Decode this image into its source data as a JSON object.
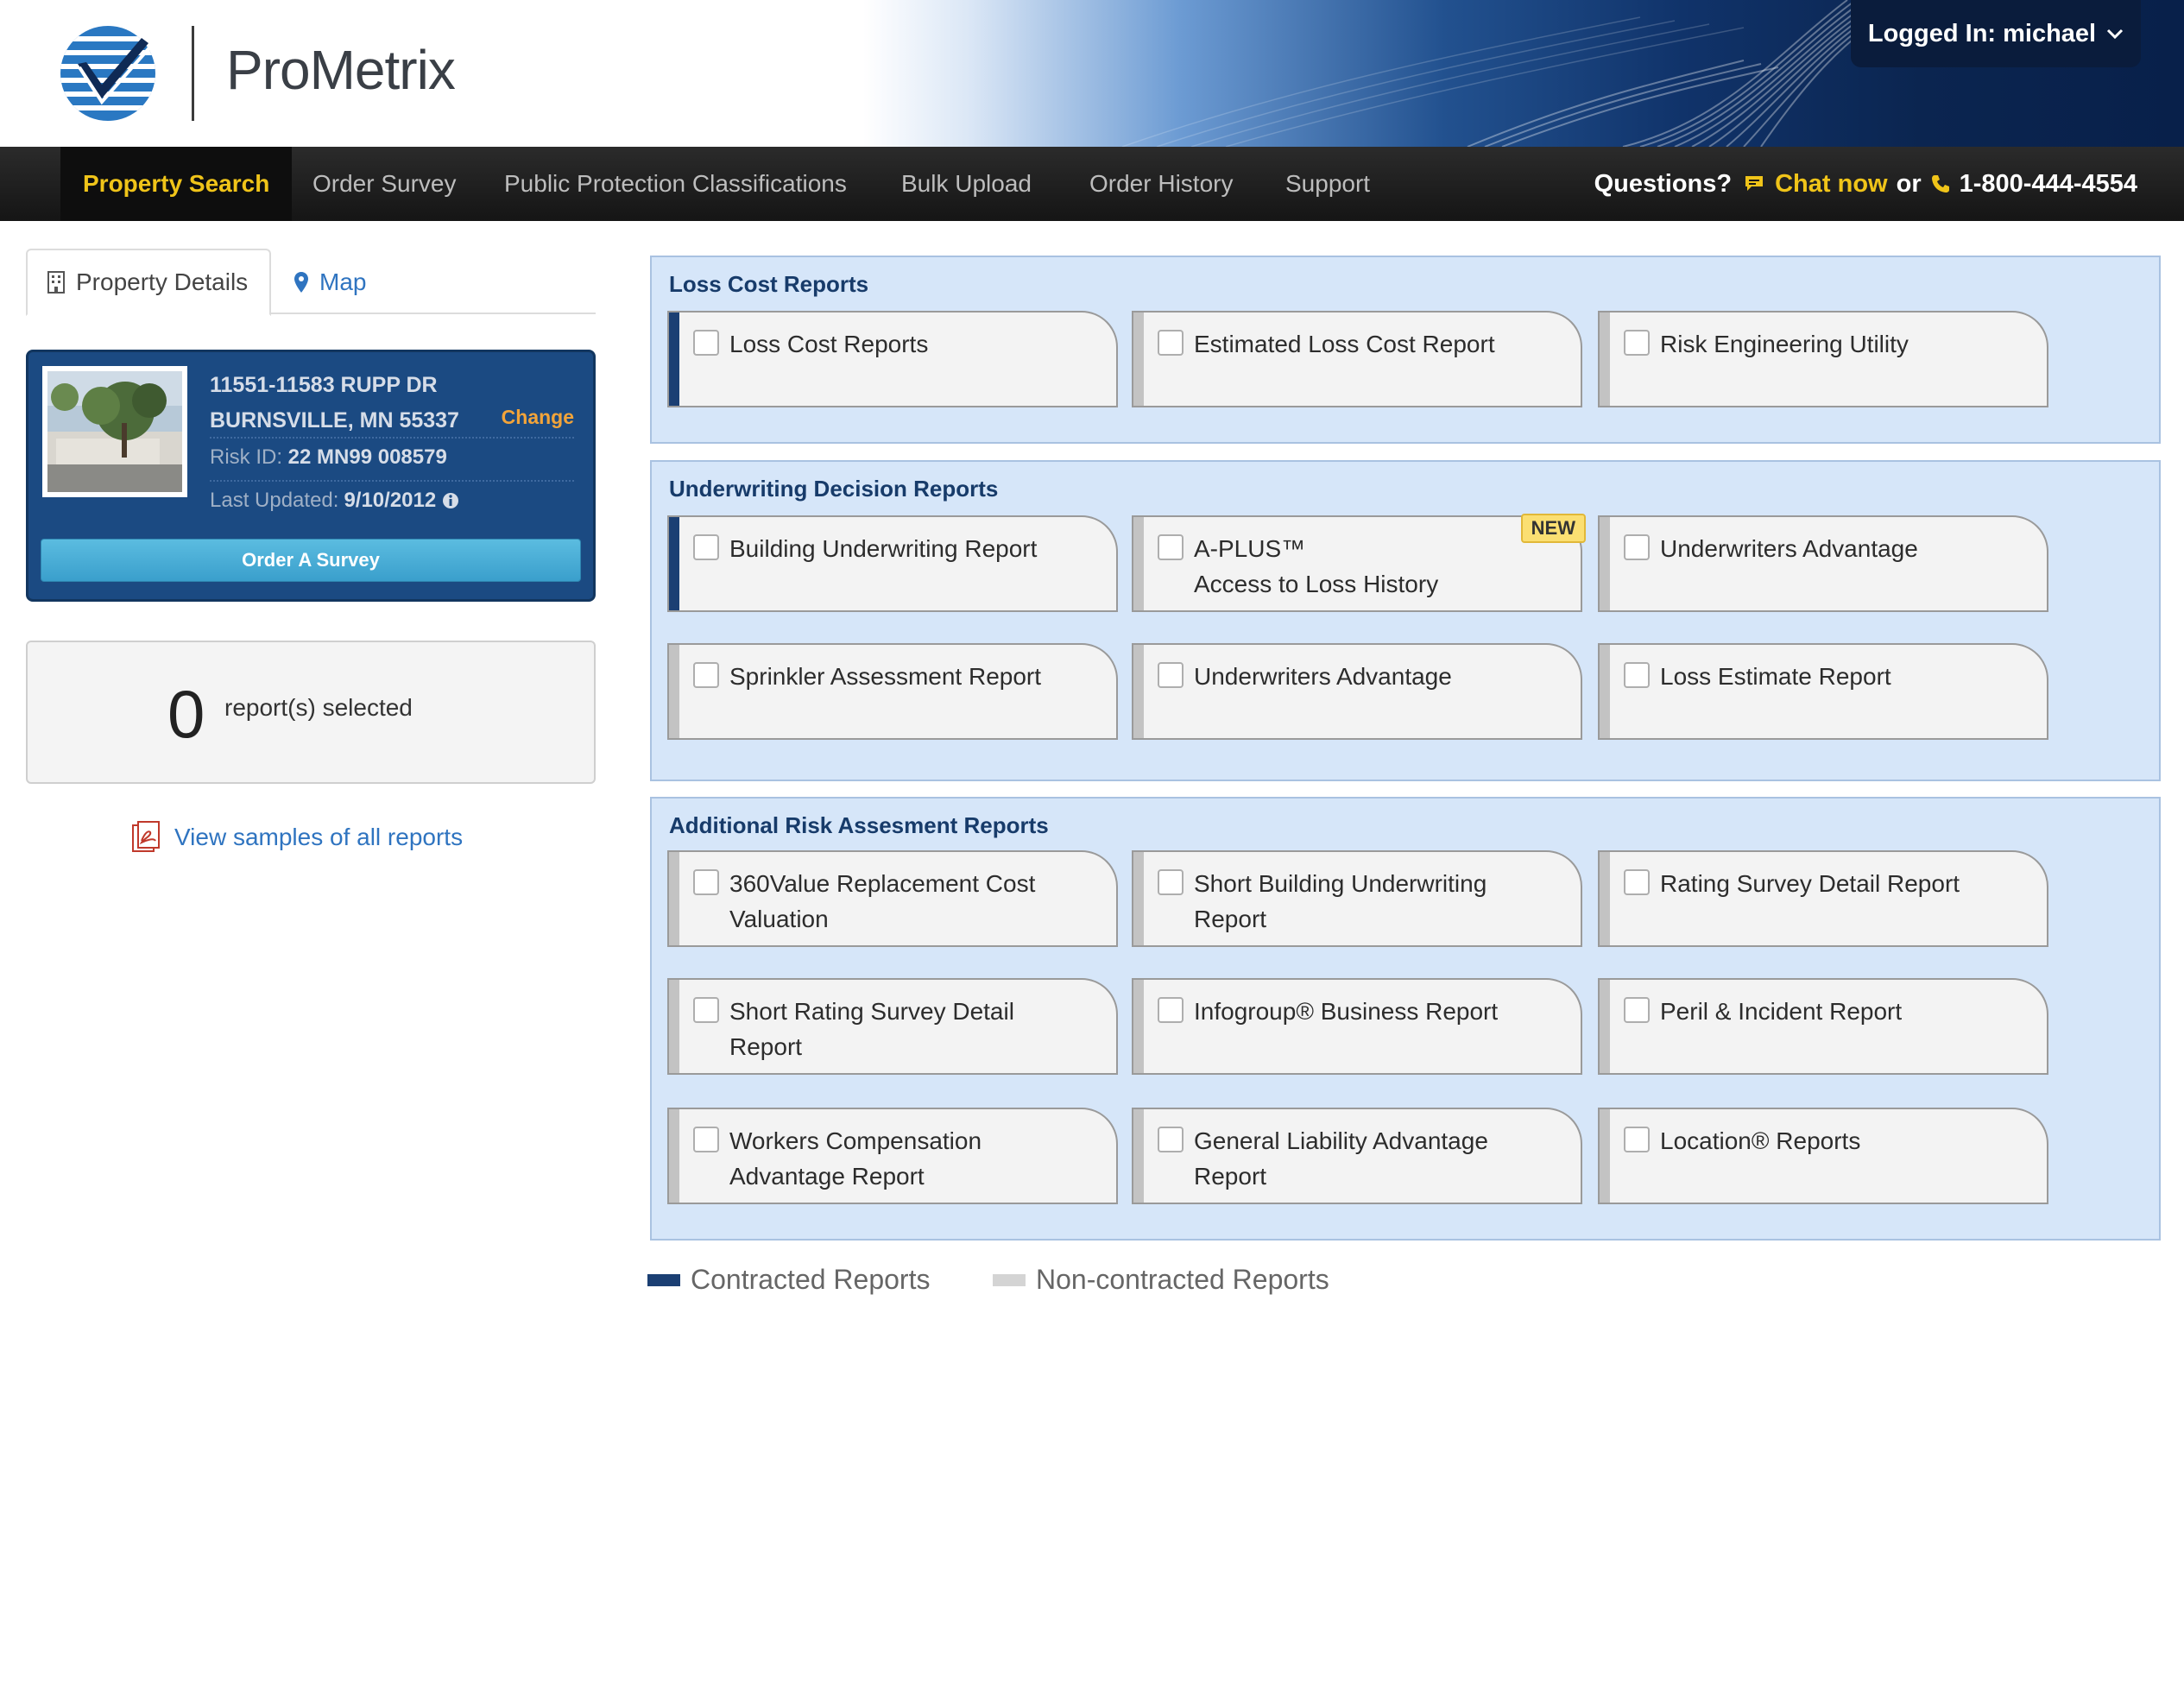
{
  "brand": {
    "name": "ProMetrix",
    "accent": "#f0c419",
    "navy": "#1b4a82"
  },
  "user": {
    "logged_in_label": "Logged In: michael"
  },
  "nav": {
    "items": [
      {
        "label": "Property Search",
        "active": true
      },
      {
        "label": "Order Survey"
      },
      {
        "label": "Public Protection Classifications"
      },
      {
        "label": "Bulk Upload"
      },
      {
        "label": "Order History"
      },
      {
        "label": "Support"
      }
    ],
    "help": {
      "questions": "Questions?",
      "chat": "Chat now",
      "or": "or",
      "phone": "1-800-444-4554"
    }
  },
  "left": {
    "tabs": {
      "details": "Property Details",
      "map": "Map"
    },
    "property": {
      "address1": "11551-11583 RUPP DR",
      "address2": "BURNSVILLE, MN 55337",
      "change": "Change",
      "risk_label": "Risk ID:",
      "risk_id": "22 MN99 008579",
      "updated_label": "Last Updated:",
      "updated": "9/10/2012",
      "order_button": "Order A Survey"
    },
    "selected": {
      "count": "0",
      "label": "report(s) selected"
    },
    "samples_link": "View samples of all reports"
  },
  "sections": {
    "loss_cost": {
      "title": "Loss Cost Reports",
      "cards": [
        {
          "label": "Loss Cost Reports",
          "contracted": true
        },
        {
          "label": "Estimated Loss Cost Report",
          "contracted": false
        },
        {
          "label": "Risk Engineering Utility",
          "contracted": false
        }
      ]
    },
    "underwriting": {
      "title": "Underwriting Decision Reports",
      "badge": "NEW",
      "cards": [
        {
          "label": "Building Underwriting Report",
          "contracted": true
        },
        {
          "label": "A-PLUS™",
          "label2": "Access to Loss History",
          "contracted": false
        },
        {
          "label": "Underwriters Advantage",
          "contracted": false
        },
        {
          "label": "Sprinkler Assessment Report",
          "contracted": false
        },
        {
          "label": "Underwriters Advantage",
          "contracted": false
        },
        {
          "label": "Loss Estimate Report",
          "contracted": false
        }
      ]
    },
    "additional": {
      "title": "Additional Risk Assesment Reports",
      "cards": [
        {
          "label": "360Value Replacement Cost",
          "label2": "Valuation",
          "contracted": false
        },
        {
          "label": "Short Building Underwriting",
          "label2": "Report",
          "contracted": false
        },
        {
          "label": "Rating Survey Detail Report",
          "contracted": false
        },
        {
          "label": "Short Rating Survey Detail",
          "label2": "Report",
          "contracted": false
        },
        {
          "label": "Infogroup® Business Report",
          "contracted": false
        },
        {
          "label": "Peril & Incident Report",
          "contracted": false
        },
        {
          "label": "Workers Compensation",
          "label2": "Advantage Report",
          "contracted": false
        },
        {
          "label": "General Liability Advantage",
          "label2": "Report",
          "contracted": false
        },
        {
          "label": "Location® Reports",
          "contracted": false
        }
      ]
    }
  },
  "legend": {
    "contracted": "Contracted Reports",
    "noncontracted": "Non-contracted Reports"
  },
  "icons": {
    "logo": "prometrix-check-globe-icon",
    "building": "building-icon",
    "map": "map-marker-icon",
    "info": "info-icon",
    "chat": "chat-bubble-icon",
    "phone": "phone-icon",
    "pdf": "pdf-icon",
    "chevron": "chevron-down-icon"
  }
}
